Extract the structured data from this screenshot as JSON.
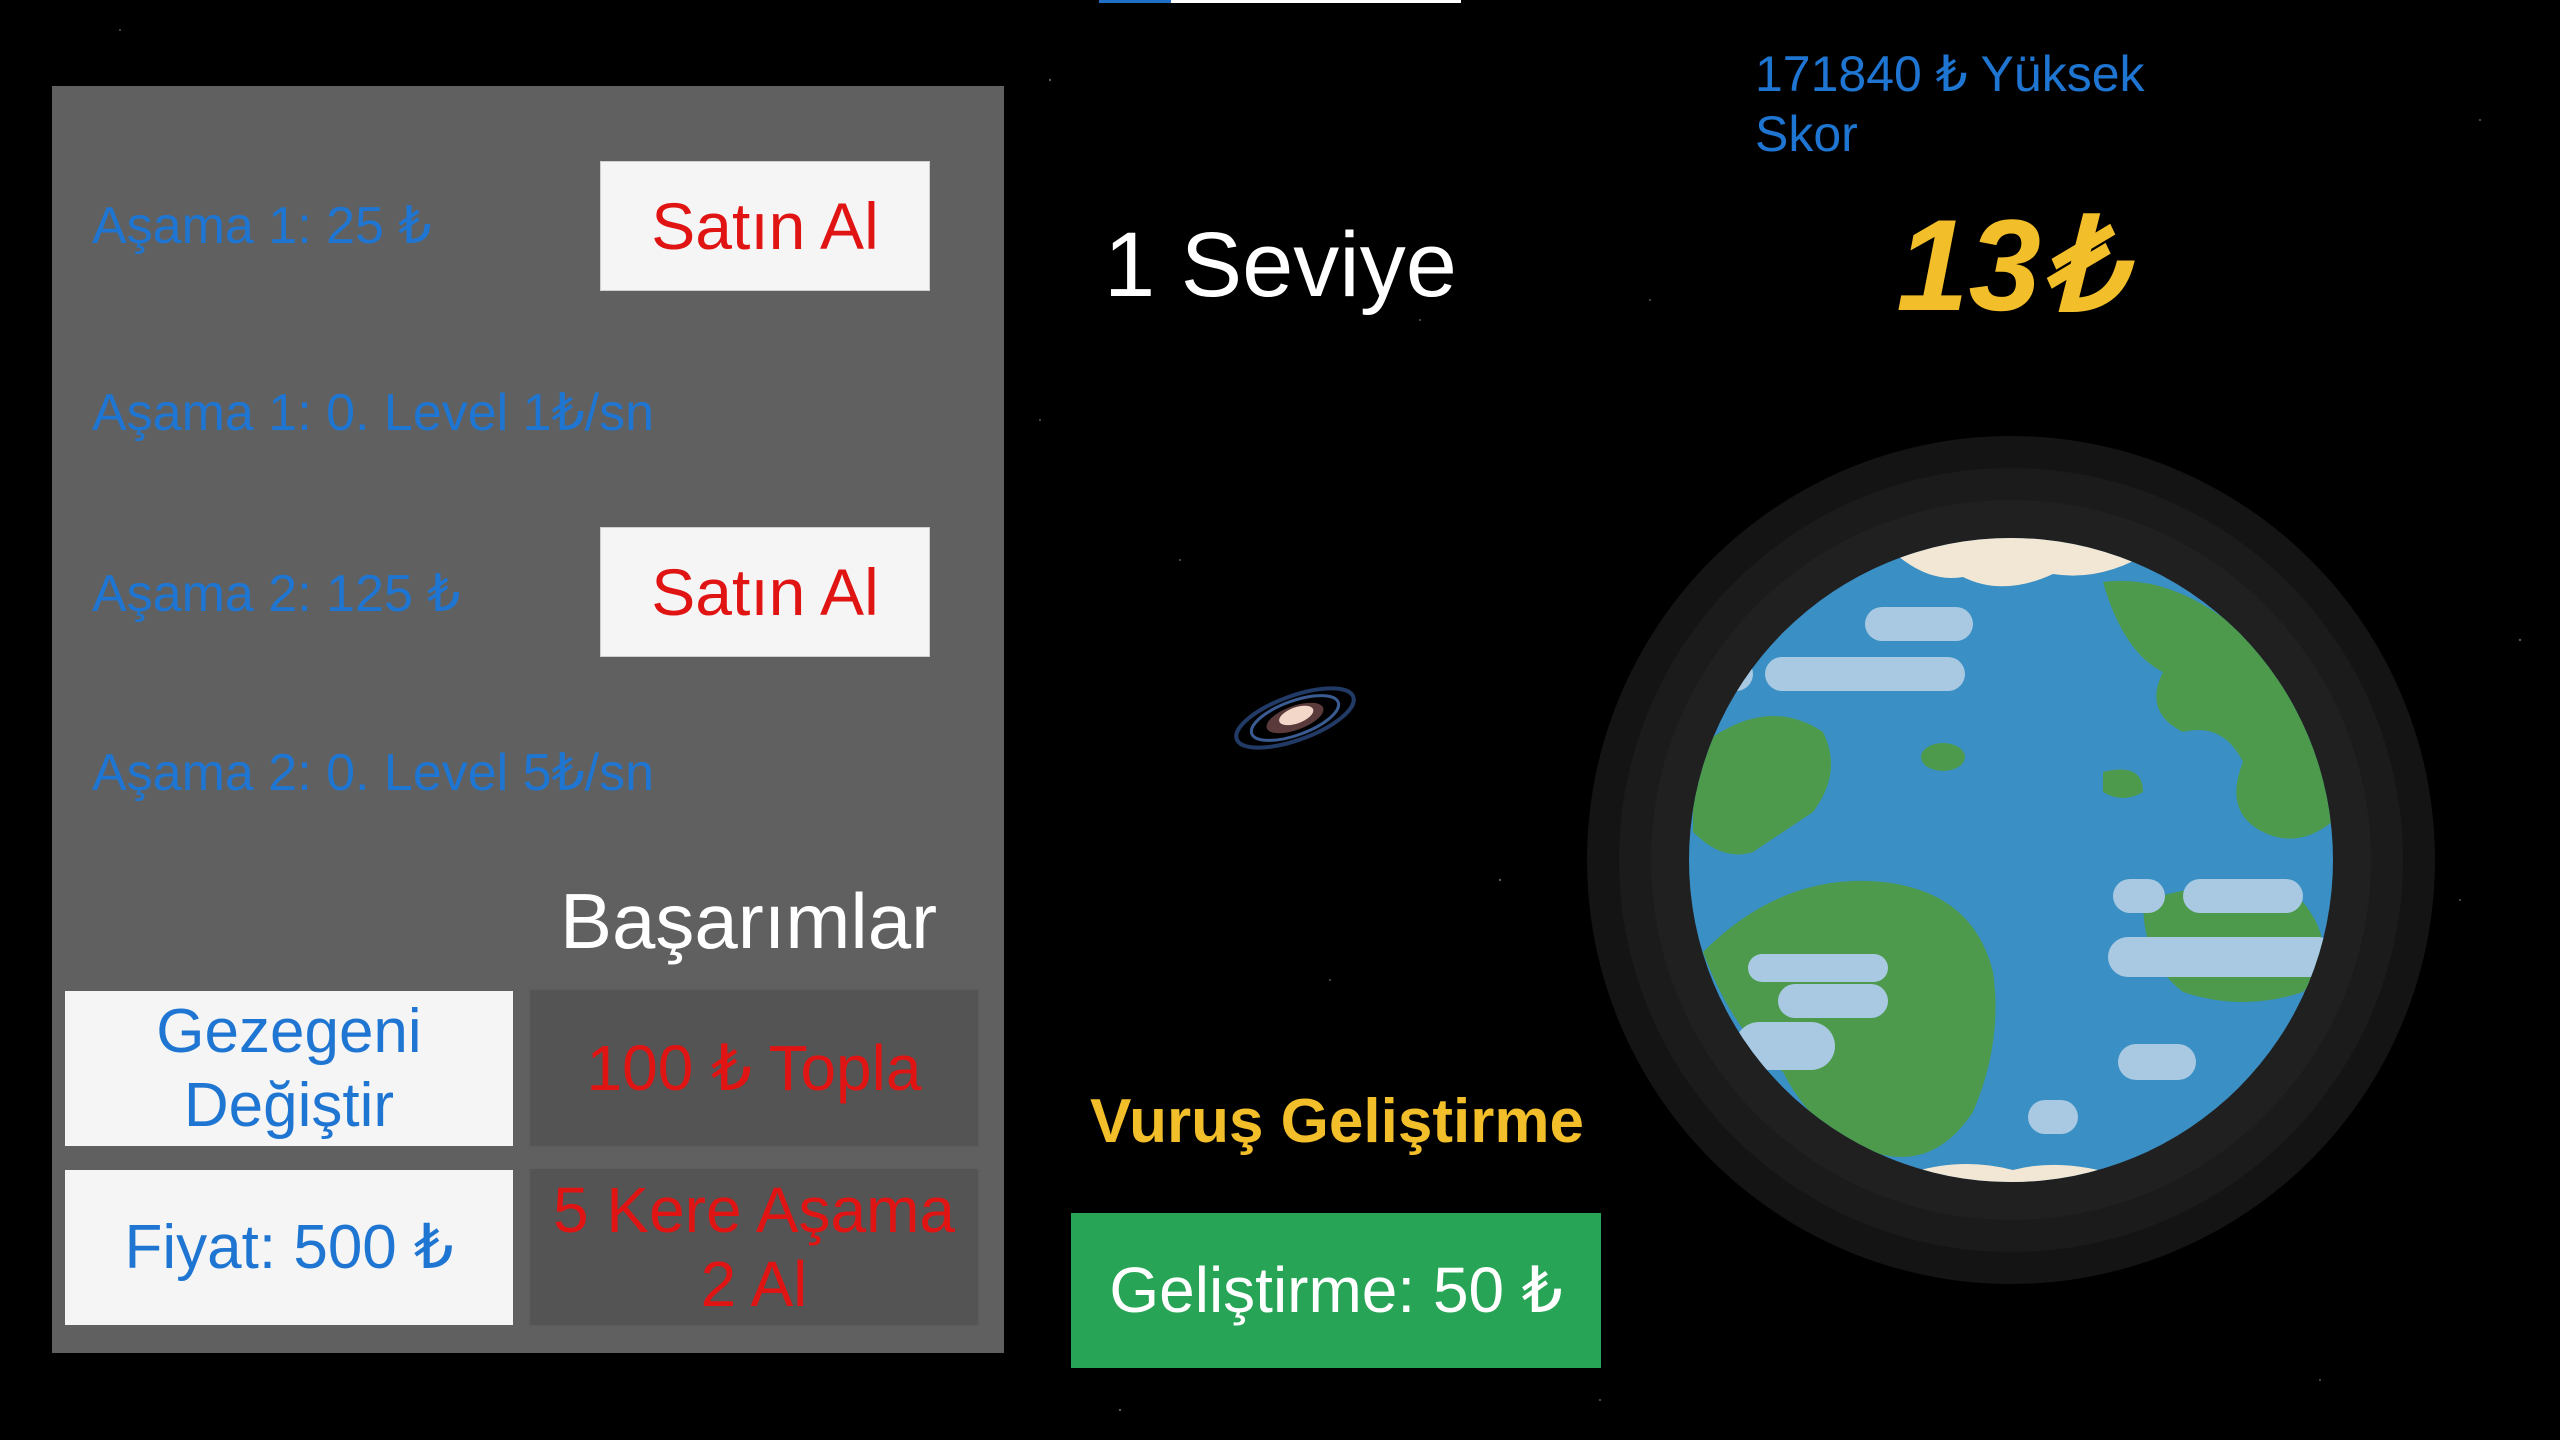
{
  "panel": {
    "stage1_price": "Aşama 1: 25 ₺",
    "stage1_buy": "Satın Al",
    "stage1_level": "Aşama 1: 0. Level 1₺/sn",
    "stage2_price": "Aşama 2: 125 ₺",
    "stage2_buy": "Satın Al",
    "stage2_level": "Aşama 2: 0. Level 5₺/sn"
  },
  "achievements": {
    "title": "Başarımlar",
    "change_planet_label": "Gezegeni Değiştir",
    "price_label": "Fiyat: 500 ₺",
    "ach1": "100 ₺ Topla",
    "ach2": "5 Kere Aşama 2 Al"
  },
  "center": {
    "level": "1 Seviye",
    "upgrade_title": "Vuruş Geliştirme",
    "upgrade_button": "Geliştirme: 50 ₺"
  },
  "right": {
    "highscore": "171840 ₺ Yüksek Skor",
    "money": "13₺"
  },
  "icons": {
    "galaxy": "galaxy-icon",
    "planet": "earth-planet-icon"
  },
  "colors": {
    "background": "#000000",
    "panel": "#606060",
    "blue_text": "#1f76d2",
    "red_text": "#e11414",
    "gold": "#f2be29",
    "green_button": "#27a455",
    "ocean": "#3a8fc4",
    "land": "#4d9a4d"
  },
  "top_progress": 0.2
}
